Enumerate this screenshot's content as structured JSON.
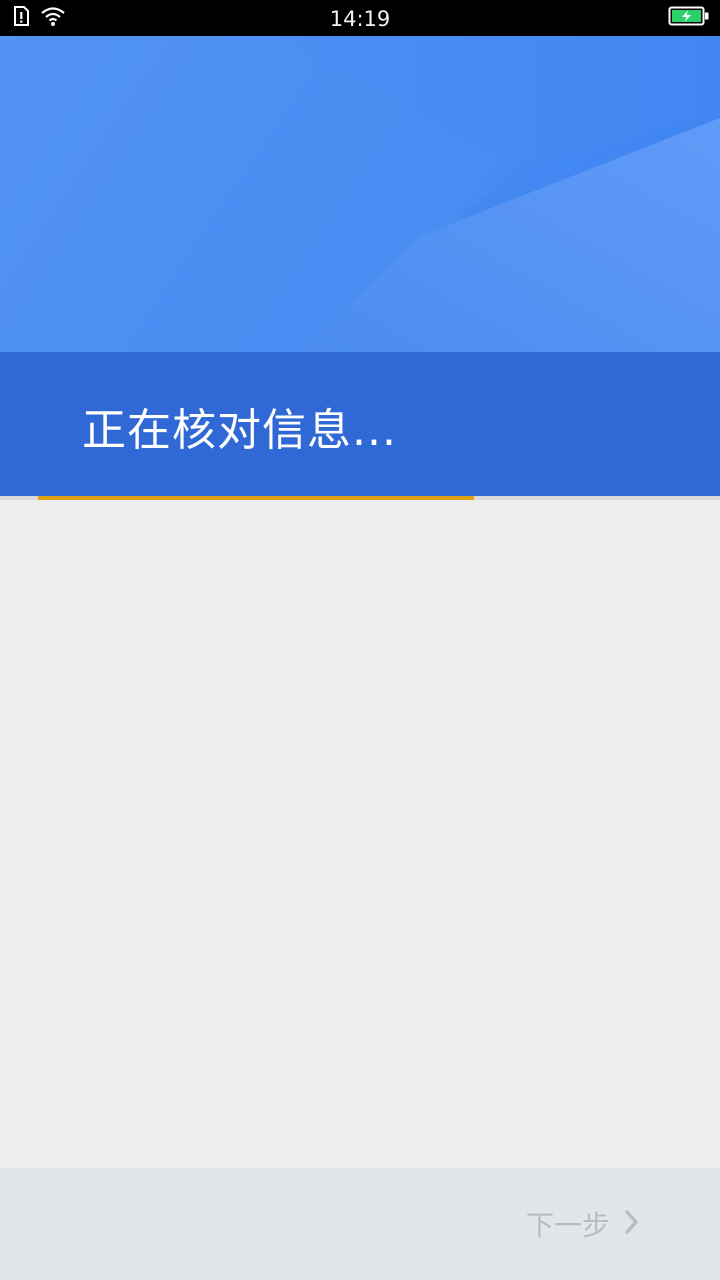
{
  "status_bar": {
    "time": "14:19",
    "icons": {
      "left": [
        "sim-alert-icon",
        "wifi-icon"
      ],
      "right": [
        "battery-charging-icon"
      ]
    }
  },
  "header": {
    "title": "正在核对信息..."
  },
  "progress": {
    "fraction": 0.64
  },
  "footer": {
    "next_label": "下一步",
    "next_icon": "chevron-right-icon"
  },
  "colors": {
    "status_bar": "#000000",
    "header_light": "#4f8ff0",
    "header_band": "#3069d6",
    "progress": "#e0a318",
    "background": "#eeeeee",
    "footer": "#e3e6e9",
    "disabled_text": "#b7bdc3",
    "battery": "#2bd26b"
  }
}
